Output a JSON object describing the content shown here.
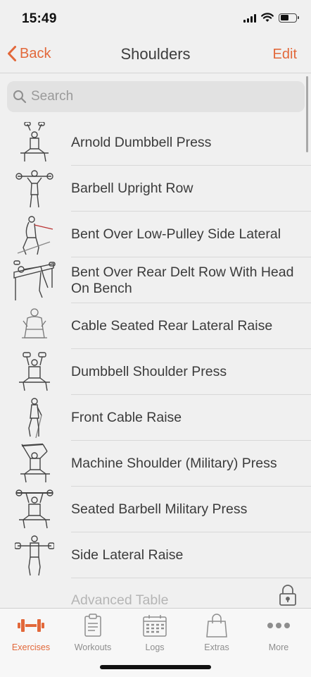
{
  "status": {
    "time": "15:49"
  },
  "nav": {
    "back_label": "Back",
    "title": "Shoulders",
    "edit_label": "Edit"
  },
  "search": {
    "placeholder": "Search"
  },
  "exercises": [
    {
      "label": "Arnold Dumbbell Press",
      "icon": "overhead-press-figure-icon"
    },
    {
      "label": "Barbell Upright Row",
      "icon": "upright-row-figure-icon"
    },
    {
      "label": "Bent Over Low-Pulley Side Lateral",
      "icon": "cable-lateral-figure-icon"
    },
    {
      "label": "Bent Over Rear Delt Row With Head On Bench",
      "icon": "rear-delt-row-figure-icon"
    },
    {
      "label": "Cable Seated Rear Lateral Raise",
      "icon": "seated-rear-raise-figure-icon"
    },
    {
      "label": "Dumbbell Shoulder Press",
      "icon": "dumbbell-press-figure-icon"
    },
    {
      "label": "Front Cable Raise",
      "icon": "front-raise-figure-icon"
    },
    {
      "label": "Machine Shoulder (Military) Press",
      "icon": "machine-press-figure-icon"
    },
    {
      "label": "Seated Barbell Military Press",
      "icon": "barbell-press-figure-icon"
    },
    {
      "label": "Side Lateral Raise",
      "icon": "side-raise-figure-icon"
    }
  ],
  "locked_item": {
    "label": "Advanced Table",
    "icon": "lock-icon"
  },
  "tabs": [
    {
      "label": "Exercises",
      "icon": "dumbbell-icon",
      "active": true
    },
    {
      "label": "Workouts",
      "icon": "clipboard-icon",
      "active": false
    },
    {
      "label": "Logs",
      "icon": "calendar-icon",
      "active": false
    },
    {
      "label": "Extras",
      "icon": "shopping-bag-icon",
      "active": false
    },
    {
      "label": "More",
      "icon": "more-dots-icon",
      "active": false
    }
  ],
  "colors": {
    "accent": "#e2683a",
    "inactive": "#8e8e8e",
    "background": "#f0f0f0"
  }
}
